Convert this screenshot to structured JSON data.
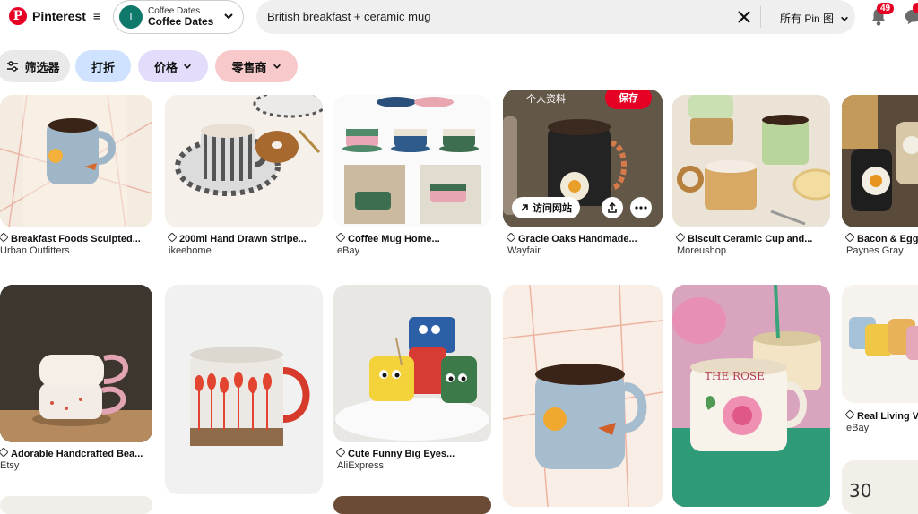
{
  "header": {
    "brand": "Pinterest",
    "menu_icon": "≡",
    "board": {
      "avatar_letter": "I",
      "small": "Coffee Dates",
      "big": "Coffee Dates"
    },
    "search": {
      "value": "British breakfast + ceramic mug",
      "filter_label": "所有 Pin 图"
    },
    "notifications_count": "49"
  },
  "filters": [
    {
      "label": "筛选器",
      "color": "#e9e9e9"
    },
    {
      "label": "打折",
      "color": "#cfe2ff"
    },
    {
      "label": "价格",
      "color": "#e3dcfb"
    },
    {
      "label": "零售商",
      "color": "#f8c9cb"
    }
  ],
  "pins": [
    {
      "title": "Breakfast Foods Sculpted...",
      "source": "Urban Outfitters"
    },
    {
      "title": "200ml Hand Drawn Stripe...",
      "source": "ikeehome"
    },
    {
      "title": "Coffee Mug Home...",
      "source": "eBay"
    },
    {
      "title": "Gracie Oaks Handmade...",
      "source": "Wayfair",
      "overlay_visit": "访问网站",
      "overlay_save": "保存",
      "overlay_top": "个人资料"
    },
    {
      "title": "Biscuit Ceramic Cup and...",
      "source": "Moreushop"
    },
    {
      "title": "Bacon & Egg...",
      "source": "Paynes Gray"
    },
    {
      "title": "Adorable Handcrafted Bea...",
      "source": "Etsy"
    },
    {
      "title": "Cute Funny Big Eyes...",
      "source": "AliExpress"
    },
    {
      "title": "Real Living V...",
      "source": "eBay"
    }
  ],
  "misc": {
    "calendar_number": "30",
    "mug_text": "THE ROSE"
  },
  "colors": {
    "brand": "#e60023",
    "avatar": "#0f7a6c"
  }
}
